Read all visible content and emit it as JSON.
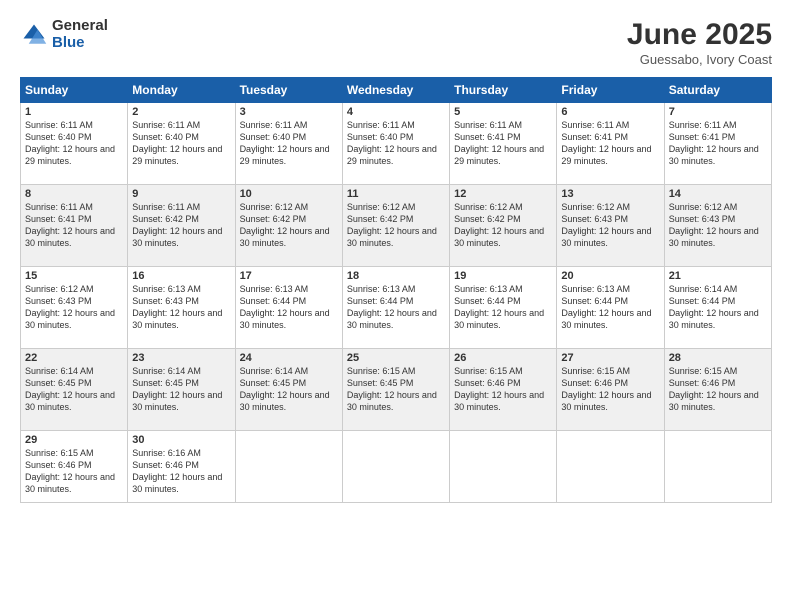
{
  "logo": {
    "general": "General",
    "blue": "Blue"
  },
  "title": "June 2025",
  "subtitle": "Guessabo, Ivory Coast",
  "days_of_week": [
    "Sunday",
    "Monday",
    "Tuesday",
    "Wednesday",
    "Thursday",
    "Friday",
    "Saturday"
  ],
  "weeks": [
    [
      {
        "day": "1",
        "sunrise": "6:11 AM",
        "sunset": "6:40 PM",
        "daylight": "12 hours and 29 minutes."
      },
      {
        "day": "2",
        "sunrise": "6:11 AM",
        "sunset": "6:40 PM",
        "daylight": "12 hours and 29 minutes."
      },
      {
        "day": "3",
        "sunrise": "6:11 AM",
        "sunset": "6:40 PM",
        "daylight": "12 hours and 29 minutes."
      },
      {
        "day": "4",
        "sunrise": "6:11 AM",
        "sunset": "6:40 PM",
        "daylight": "12 hours and 29 minutes."
      },
      {
        "day": "5",
        "sunrise": "6:11 AM",
        "sunset": "6:41 PM",
        "daylight": "12 hours and 29 minutes."
      },
      {
        "day": "6",
        "sunrise": "6:11 AM",
        "sunset": "6:41 PM",
        "daylight": "12 hours and 29 minutes."
      },
      {
        "day": "7",
        "sunrise": "6:11 AM",
        "sunset": "6:41 PM",
        "daylight": "12 hours and 30 minutes."
      }
    ],
    [
      {
        "day": "8",
        "sunrise": "6:11 AM",
        "sunset": "6:41 PM",
        "daylight": "12 hours and 30 minutes."
      },
      {
        "day": "9",
        "sunrise": "6:11 AM",
        "sunset": "6:42 PM",
        "daylight": "12 hours and 30 minutes."
      },
      {
        "day": "10",
        "sunrise": "6:12 AM",
        "sunset": "6:42 PM",
        "daylight": "12 hours and 30 minutes."
      },
      {
        "day": "11",
        "sunrise": "6:12 AM",
        "sunset": "6:42 PM",
        "daylight": "12 hours and 30 minutes."
      },
      {
        "day": "12",
        "sunrise": "6:12 AM",
        "sunset": "6:42 PM",
        "daylight": "12 hours and 30 minutes."
      },
      {
        "day": "13",
        "sunrise": "6:12 AM",
        "sunset": "6:43 PM",
        "daylight": "12 hours and 30 minutes."
      },
      {
        "day": "14",
        "sunrise": "6:12 AM",
        "sunset": "6:43 PM",
        "daylight": "12 hours and 30 minutes."
      }
    ],
    [
      {
        "day": "15",
        "sunrise": "6:12 AM",
        "sunset": "6:43 PM",
        "daylight": "12 hours and 30 minutes."
      },
      {
        "day": "16",
        "sunrise": "6:13 AM",
        "sunset": "6:43 PM",
        "daylight": "12 hours and 30 minutes."
      },
      {
        "day": "17",
        "sunrise": "6:13 AM",
        "sunset": "6:44 PM",
        "daylight": "12 hours and 30 minutes."
      },
      {
        "day": "18",
        "sunrise": "6:13 AM",
        "sunset": "6:44 PM",
        "daylight": "12 hours and 30 minutes."
      },
      {
        "day": "19",
        "sunrise": "6:13 AM",
        "sunset": "6:44 PM",
        "daylight": "12 hours and 30 minutes."
      },
      {
        "day": "20",
        "sunrise": "6:13 AM",
        "sunset": "6:44 PM",
        "daylight": "12 hours and 30 minutes."
      },
      {
        "day": "21",
        "sunrise": "6:14 AM",
        "sunset": "6:44 PM",
        "daylight": "12 hours and 30 minutes."
      }
    ],
    [
      {
        "day": "22",
        "sunrise": "6:14 AM",
        "sunset": "6:45 PM",
        "daylight": "12 hours and 30 minutes."
      },
      {
        "day": "23",
        "sunrise": "6:14 AM",
        "sunset": "6:45 PM",
        "daylight": "12 hours and 30 minutes."
      },
      {
        "day": "24",
        "sunrise": "6:14 AM",
        "sunset": "6:45 PM",
        "daylight": "12 hours and 30 minutes."
      },
      {
        "day": "25",
        "sunrise": "6:15 AM",
        "sunset": "6:45 PM",
        "daylight": "12 hours and 30 minutes."
      },
      {
        "day": "26",
        "sunrise": "6:15 AM",
        "sunset": "6:46 PM",
        "daylight": "12 hours and 30 minutes."
      },
      {
        "day": "27",
        "sunrise": "6:15 AM",
        "sunset": "6:46 PM",
        "daylight": "12 hours and 30 minutes."
      },
      {
        "day": "28",
        "sunrise": "6:15 AM",
        "sunset": "6:46 PM",
        "daylight": "12 hours and 30 minutes."
      }
    ],
    [
      {
        "day": "29",
        "sunrise": "6:15 AM",
        "sunset": "6:46 PM",
        "daylight": "12 hours and 30 minutes."
      },
      {
        "day": "30",
        "sunrise": "6:16 AM",
        "sunset": "6:46 PM",
        "daylight": "12 hours and 30 minutes."
      },
      null,
      null,
      null,
      null,
      null
    ]
  ]
}
